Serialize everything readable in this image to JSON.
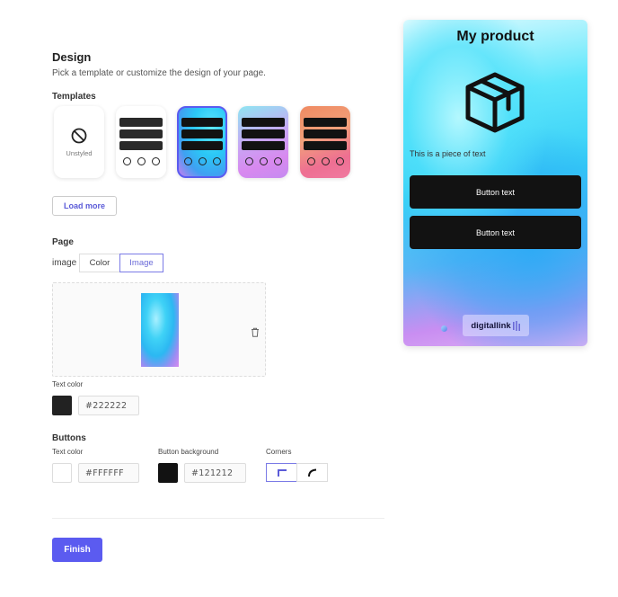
{
  "design": {
    "title": "Design",
    "subtitle": "Pick a template or customize the design of your page."
  },
  "templates": {
    "heading": "Templates",
    "items": [
      {
        "name": "unstyled",
        "label": "Unstyled",
        "selected": false
      },
      {
        "name": "white",
        "selected": false
      },
      {
        "name": "blue-gradient",
        "selected": true
      },
      {
        "name": "pastel-gradient",
        "selected": false
      },
      {
        "name": "warm-gradient",
        "selected": false
      }
    ],
    "load_more": "Load more"
  },
  "page": {
    "heading": "Page",
    "background_label": "image",
    "options": [
      "Color",
      "Image"
    ],
    "selected_option": "Image",
    "text_color_label": "Text color",
    "text_color": "#222222"
  },
  "buttons": {
    "heading": "Buttons",
    "text_color_label": "Text color",
    "text_color": "#FFFFFF",
    "background_label": "Button background",
    "background": "#121212",
    "corners_label": "Corners",
    "corners_options": [
      "square",
      "rounded"
    ],
    "corners_selected": "square"
  },
  "footer": {
    "finish": "Finish"
  },
  "preview": {
    "title": "My product",
    "icon": "package-box-icon",
    "text": "This is a piece of text",
    "buttons": [
      "Button text",
      "Button text"
    ],
    "logo_text": "digitallink"
  },
  "colors": {
    "accent": "#5b5bf0",
    "button_dark": "#121212",
    "text_dark": "#222222"
  }
}
